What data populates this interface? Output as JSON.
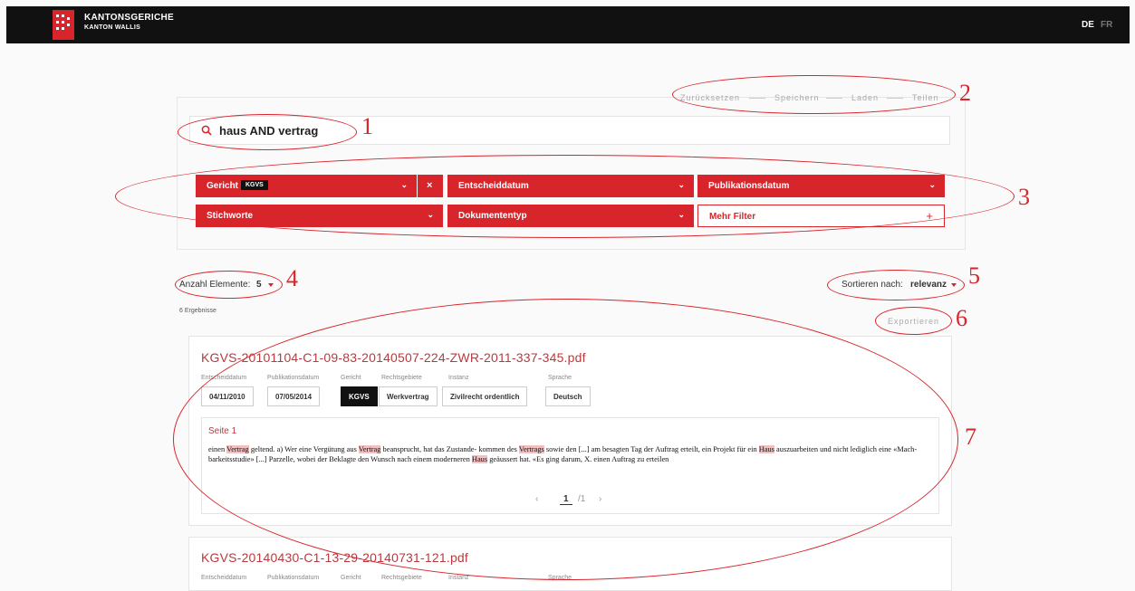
{
  "header": {
    "brand_title": "KANTONSGERICHE",
    "brand_subtitle": "KANTON WALLIS",
    "languages": [
      "DE",
      "FR"
    ],
    "active_language": "DE"
  },
  "search_panel": {
    "actions": [
      "Zurücksetzen",
      "Speichern",
      "Laden",
      "Teilen"
    ],
    "query": "haus AND vertrag",
    "filters": [
      {
        "label": "Gericht",
        "chip": "KGVS"
      },
      {
        "label": "Entscheiddatum"
      },
      {
        "label": "Publikationsdatum"
      },
      {
        "label": "Stichworte"
      },
      {
        "label": "Dokumententyp"
      },
      {
        "label": "Mehr Filter"
      }
    ]
  },
  "results_controls": {
    "items_label": "Anzahl Elemente:",
    "items_value": "5",
    "sort_label": "Sortieren nach:",
    "sort_value": "relevanz",
    "count_text": "6 Ergebnisse",
    "export_label": "Exportieren"
  },
  "results": [
    {
      "title": "KGVS-20101104-C1-09-83-20140507-224-ZWR-2011-337-345.pdf",
      "meta_labels": [
        "Entscheiddatum",
        "Publikationsdatum",
        "Gericht",
        "Rechtsgebiete",
        "Instanz",
        "Sprache"
      ],
      "meta_values": [
        "04/11/2010",
        "07/05/2014",
        "KGVS",
        "Werkvertrag",
        "Zivilrecht ordentlich",
        "Deutsch"
      ],
      "snippet": {
        "page": "Seite 1",
        "text": [
          {
            "t": "einen "
          },
          {
            "t": "Vertrag",
            "hl": true
          },
          {
            "t": " geltend. a) Wer eine Vergütung aus "
          },
          {
            "t": "Vertrag",
            "hl": true
          },
          {
            "t": " beansprucht, hat das Zustande- kommen des "
          },
          {
            "t": "Vertrags",
            "hl": true
          },
          {
            "t": " sowie den [...] am besagten Tag der Auftrag erteilt, ein Projekt für ein "
          },
          {
            "t": "Haus",
            "hl": true
          },
          {
            "t": " auszuarbeiten und nicht lediglich eine «Mach- barkeitsstudie» [...] Parzelle, wobei der Beklagte den Wunsch nach einem moderneren "
          },
          {
            "t": "Haus",
            "hl": true
          },
          {
            "t": " geäussert hat. «Es ging darum, X. einen Auftrag zu erteilen"
          }
        ]
      },
      "pager": {
        "prev": "‹",
        "current": "1",
        "total": "/1",
        "next": "›"
      }
    },
    {
      "title": "KGVS-20140430-C1-13-29-20140731-121.pdf",
      "meta_labels": [
        "Entscheiddatum",
        "Publikationsdatum",
        "Gericht",
        "Rechtsgebiete",
        "Instanz",
        "Sprache"
      ]
    }
  ],
  "annotations": [
    "1",
    "2",
    "3",
    "4",
    "5",
    "6",
    "7"
  ],
  "colors": {
    "accent": "#d8242b",
    "dark": "#111111"
  }
}
